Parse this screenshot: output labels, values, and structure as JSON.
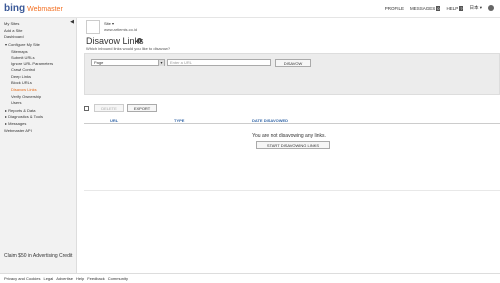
{
  "header": {
    "brand": "bing",
    "product": "Webmaster",
    "nav": {
      "profile": "PROFILE",
      "messages": "MESSAGES",
      "messages_count": "0",
      "help": "HELP",
      "help_badge": "?",
      "language": "日本 ▾"
    }
  },
  "sidebar": {
    "items": [
      {
        "label": "My Sites",
        "indent": 0
      },
      {
        "label": "Add a Site",
        "indent": 0
      },
      {
        "label": "Dashboard",
        "indent": 0
      },
      {
        "label": "▾ Configure My Site",
        "indent": 1
      },
      {
        "label": "Sitemaps",
        "indent": 2
      },
      {
        "label": "Submit URLs",
        "indent": 2
      },
      {
        "label": "Ignore URL Parameters",
        "indent": 2
      },
      {
        "label": "Crawl Control",
        "indent": 2
      },
      {
        "label": "Deep Links",
        "indent": 2
      },
      {
        "label": "Block URLs",
        "indent": 2
      },
      {
        "label": "Disavow Links",
        "indent": 2,
        "active": true
      },
      {
        "label": "Verify Ownership",
        "indent": 2
      },
      {
        "label": "Users",
        "indent": 2
      },
      {
        "label": "▸ Reports & Data",
        "indent": 1
      },
      {
        "label": "▸ Diagnostics & Tools",
        "indent": 1
      },
      {
        "label": "▸ Messages",
        "indent": 1
      },
      {
        "label": "Webmaster API",
        "indent": 0
      }
    ],
    "claim": "Claim $50 in Advertising Credit"
  },
  "site": {
    "name": "Site ▾",
    "url": "www.artiemis.co.id"
  },
  "page": {
    "title": "Disavow Links",
    "subtitle": "Which inbound links would you like to disavow?",
    "select_value": "Page",
    "url_placeholder": "Enter a URL",
    "disavow_button": "DISAVOW",
    "delete_button": "DELETE",
    "export_button": "EXPORT",
    "columns": [
      "URL",
      "TYPE",
      "DATE DISAVOWED"
    ],
    "empty_message": "You are not disavowing any links.",
    "start_button": "START DISAVOWING LINKS"
  },
  "footer": {
    "links": [
      "Privacy and Cookies",
      "Legal",
      "Advertise",
      "Help",
      "Feedback",
      "Community"
    ]
  }
}
